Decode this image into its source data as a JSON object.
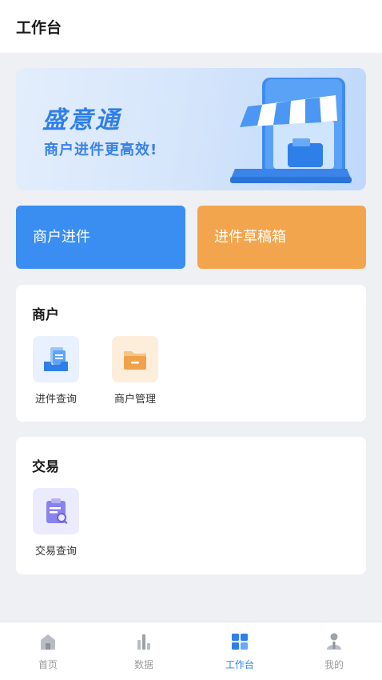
{
  "header": {
    "title": "工作台"
  },
  "banner": {
    "brand": "盛意通",
    "slogan": "商户进件更高效!"
  },
  "actions": {
    "merchant_onboarding": "商户进件",
    "drafts": "进件草稿箱"
  },
  "merchant_section": {
    "title": "商户",
    "items": [
      {
        "label": "进件查询",
        "icon": "inbox-doc-icon"
      },
      {
        "label": "商户管理",
        "icon": "folder-icon"
      }
    ]
  },
  "trade_section": {
    "title": "交易",
    "items": [
      {
        "label": "交易查询",
        "icon": "clipboard-search-icon"
      }
    ]
  },
  "tabbar": {
    "items": [
      {
        "label": "首页",
        "icon": "home-icon",
        "active": false
      },
      {
        "label": "数据",
        "icon": "bar-chart-icon",
        "active": false
      },
      {
        "label": "工作台",
        "icon": "grid-icon",
        "active": true
      },
      {
        "label": "我的",
        "icon": "user-icon",
        "active": false
      }
    ]
  },
  "colors": {
    "accent": "#2f7fe8",
    "onboarding_button": "#3a8ef2",
    "drafts_button": "#f3a54d",
    "background": "#eef0f4"
  }
}
